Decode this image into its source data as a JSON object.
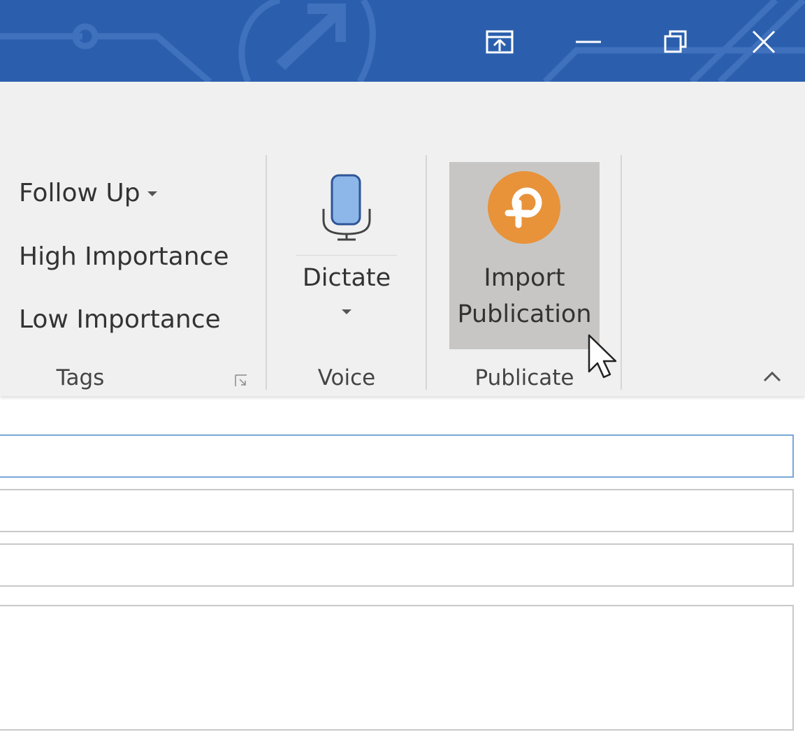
{
  "titlebar": {
    "bg": "#2b5fae",
    "buttons": [
      {
        "name": "ribbon-display-options-icon"
      },
      {
        "name": "minimize-icon"
      },
      {
        "name": "restore-icon"
      },
      {
        "name": "close-icon"
      }
    ]
  },
  "ribbon": {
    "tags": {
      "follow_up": "Follow Up",
      "high_importance": "High Importance",
      "low_importance": "Low Importance",
      "group_label": "Tags"
    },
    "voice": {
      "dictate_label": "Dictate",
      "group_label": "Voice"
    },
    "publicate": {
      "import_line1": "Import",
      "import_line2": "Publication",
      "group_label": "Publicate",
      "brand_color": "#e8923a"
    }
  },
  "form": {
    "fields": [
      {
        "value": "",
        "active": true
      },
      {
        "value": ""
      },
      {
        "value": ""
      }
    ],
    "body": ""
  }
}
